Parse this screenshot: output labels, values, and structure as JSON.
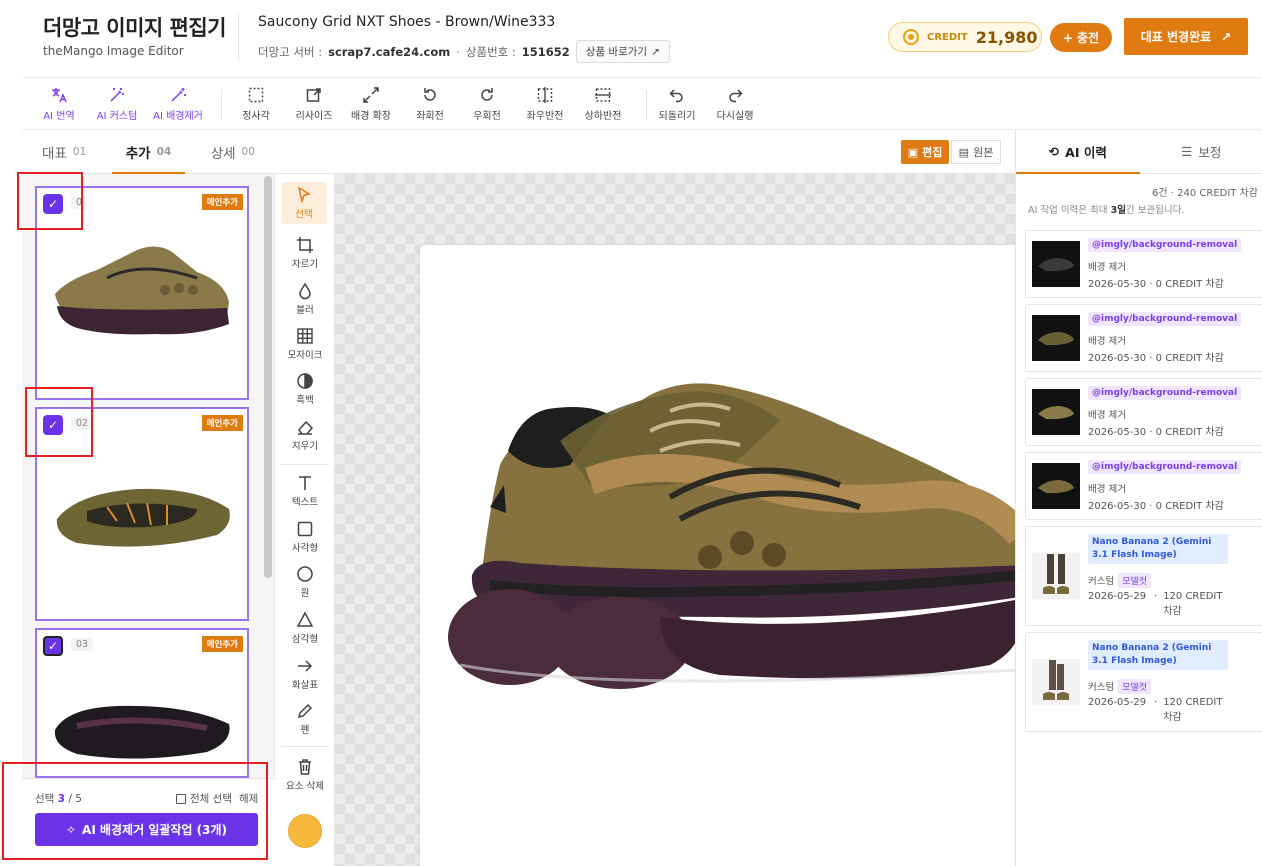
{
  "header": {
    "app_title": "더망고 이미지 편집기",
    "app_subtitle": "theMango Image Editor",
    "product_title": "Saucony Grid NXT Shoes - Brown/Wine333",
    "server_label": "더망고 서버 :",
    "server_value": "scrap7.cafe24.com",
    "product_no_label": "상품번호 :",
    "product_no_value": "151652",
    "product_link_label": "상품 바로가기",
    "credit_label": "CREDIT",
    "credit_value": "21,980",
    "charge_label": "충전",
    "done_label": "대표 변경완료"
  },
  "toolbar": {
    "ai_translate": "AI 번역",
    "ai_custom": "AI 커스텀",
    "ai_bg_remove": "AI 배경제거",
    "square": "정사각",
    "resize": "리사이즈",
    "bg_expand": "배경 확장",
    "rotate_left": "좌회전",
    "rotate_right": "우회전",
    "flip_h": "좌우반전",
    "flip_v": "상하반전",
    "undo": "되돌리기",
    "redo": "다시실행"
  },
  "left_tabs": [
    {
      "label": "대표",
      "count": "01"
    },
    {
      "label": "추가",
      "count": "04"
    },
    {
      "label": "상세",
      "count": "00"
    }
  ],
  "thumbnails": [
    {
      "index": "0",
      "badge": "메인추가"
    },
    {
      "index": "02",
      "badge": "메인추가"
    },
    {
      "index": "03",
      "badge": "메인추가"
    }
  ],
  "selection": {
    "label": "선택",
    "selected": "3",
    "total": "/ 5",
    "select_all": "전체 선택",
    "clear": "해제",
    "bulk_button": "AI 배경제거 일괄작업 (3개)"
  },
  "canvas": {
    "mode_edit": "편집",
    "mode_original": "원본"
  },
  "side_tools": {
    "select": "선택",
    "crop": "자르기",
    "blur": "블러",
    "mosaic": "모자이크",
    "bw": "흑백",
    "erase": "지우기",
    "text": "텍스트",
    "rect": "사각형",
    "circle": "원",
    "triangle": "삼각형",
    "arrow": "화살표",
    "pen": "펜",
    "delete": "요소 삭제"
  },
  "right_panel": {
    "tab_history": "AI 이력",
    "tab_adjust": "보정",
    "summary": "6건 · 240 CREDIT 차감",
    "note_prefix": "AI 작업 이력은 최대",
    "note_bold": "3일",
    "note_suffix": "간 보관됩니다.",
    "history": [
      {
        "tag": "@imgly/background-removal",
        "kind": "배경 제거",
        "date": "2026-05-30",
        "cost": "0 CREDIT 차감"
      },
      {
        "tag": "@imgly/background-removal",
        "kind": "배경 제거",
        "date": "2026-05-30",
        "cost": "0 CREDIT 차감"
      },
      {
        "tag": "@imgly/background-removal",
        "kind": "배경 제거",
        "date": "2026-05-30",
        "cost": "0 CREDIT 차감"
      },
      {
        "tag": "@imgly/background-removal",
        "kind": "배경 제거",
        "date": "2026-05-30",
        "cost": "0 CREDIT 차감"
      },
      {
        "tag": "Nano Banana 2 (Gemini 3.1 Flash Image)",
        "kind": "커스텀",
        "model": "모델컷",
        "date": "2026-05-29",
        "cost": "120 CREDIT 차감"
      },
      {
        "tag": "Nano Banana 2 (Gemini 3.1 Flash Image)",
        "kind": "커스텀",
        "model": "모델컷",
        "date": "2026-05-29",
        "cost": "120 CREDIT 차감"
      }
    ]
  }
}
